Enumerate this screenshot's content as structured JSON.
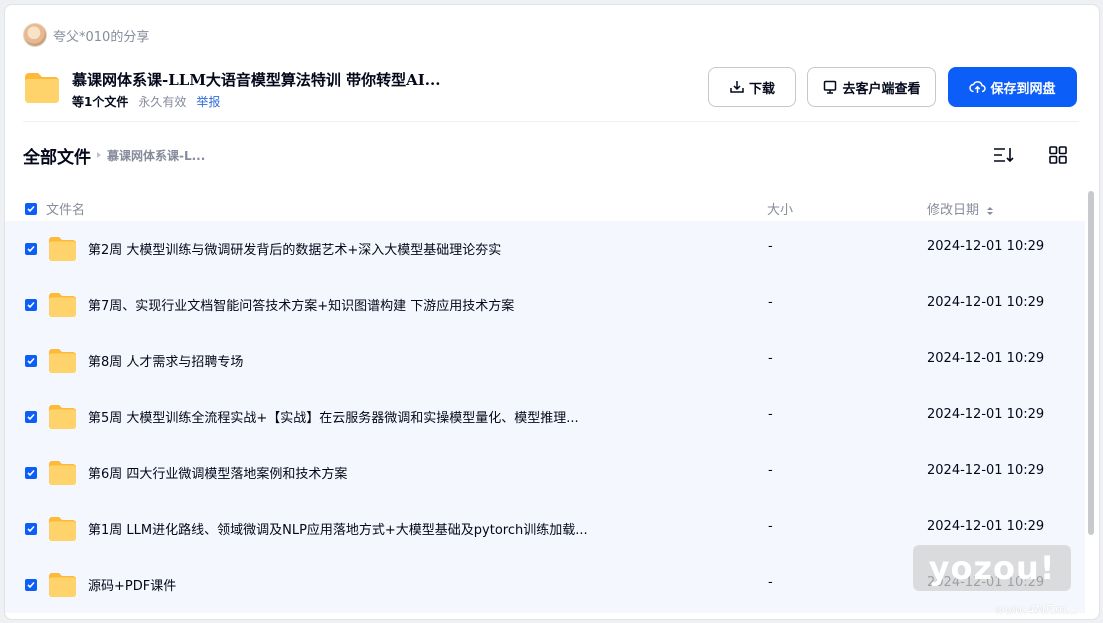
{
  "share": {
    "sharer_name": "夸父*010的分享",
    "title": "慕课网体系课-LLM大语音模型算法特训 带你转型AI...",
    "file_count": "等1个文件",
    "validity": "永久有效",
    "report_label": "举报"
  },
  "actions": {
    "download_label": "下载",
    "client_label": "去客户端查看",
    "save_label": "保存到网盘"
  },
  "breadcrumb": {
    "root": "全部文件",
    "current": "慕课网体系课-L..."
  },
  "table": {
    "columns": {
      "name": "文件名",
      "size": "大小",
      "modified": "修改日期"
    },
    "rows": [
      {
        "name": "第2周 大模型训练与微调研发背后的数据艺术+深入大模型基础理论夯实",
        "size": "-",
        "modified": "2024-12-01 10:29",
        "checked": true
      },
      {
        "name": "第7周、实现行业文档智能问答技术方案+知识图谱构建 下游应用技术方案",
        "size": "-",
        "modified": "2024-12-01 10:29",
        "checked": true
      },
      {
        "name": "第8周 人才需求与招聘专场",
        "size": "-",
        "modified": "2024-12-01 10:29",
        "checked": true
      },
      {
        "name": "第5周 大模型训练全流程实战+【实战】在云服务器微调和实操模型量化、模型推理...",
        "size": "-",
        "modified": "2024-12-01 10:29",
        "checked": true
      },
      {
        "name": "第6周 四大行业微调模型落地案例和技术方案",
        "size": "-",
        "modified": "2024-12-01 10:29",
        "checked": true
      },
      {
        "name": "第1周 LLM进化路线、领域微调及NLP应用落地方式+大模型基础及pytorch训练加载...",
        "size": "-",
        "modified": "2024-12-01 10:29",
        "checked": true
      },
      {
        "name": "源码+PDF课件",
        "size": "-",
        "modified": "2024-12-01 10:29",
        "checked": true
      }
    ]
  },
  "watermark": {
    "text": "yozou!",
    "url": "www.4MF.m..."
  },
  "colors": {
    "primary": "#0b5ef7",
    "folder": "#ffc65a",
    "muted": "#878c9c",
    "row_bg": "#f4f7fd"
  },
  "icons": [
    "avatar",
    "folder-icon",
    "download-icon",
    "desktop-icon",
    "cloud-upload-icon",
    "sort-icon",
    "grid-view-icon",
    "checkbox-icon",
    "sort-arrows-icon"
  ]
}
